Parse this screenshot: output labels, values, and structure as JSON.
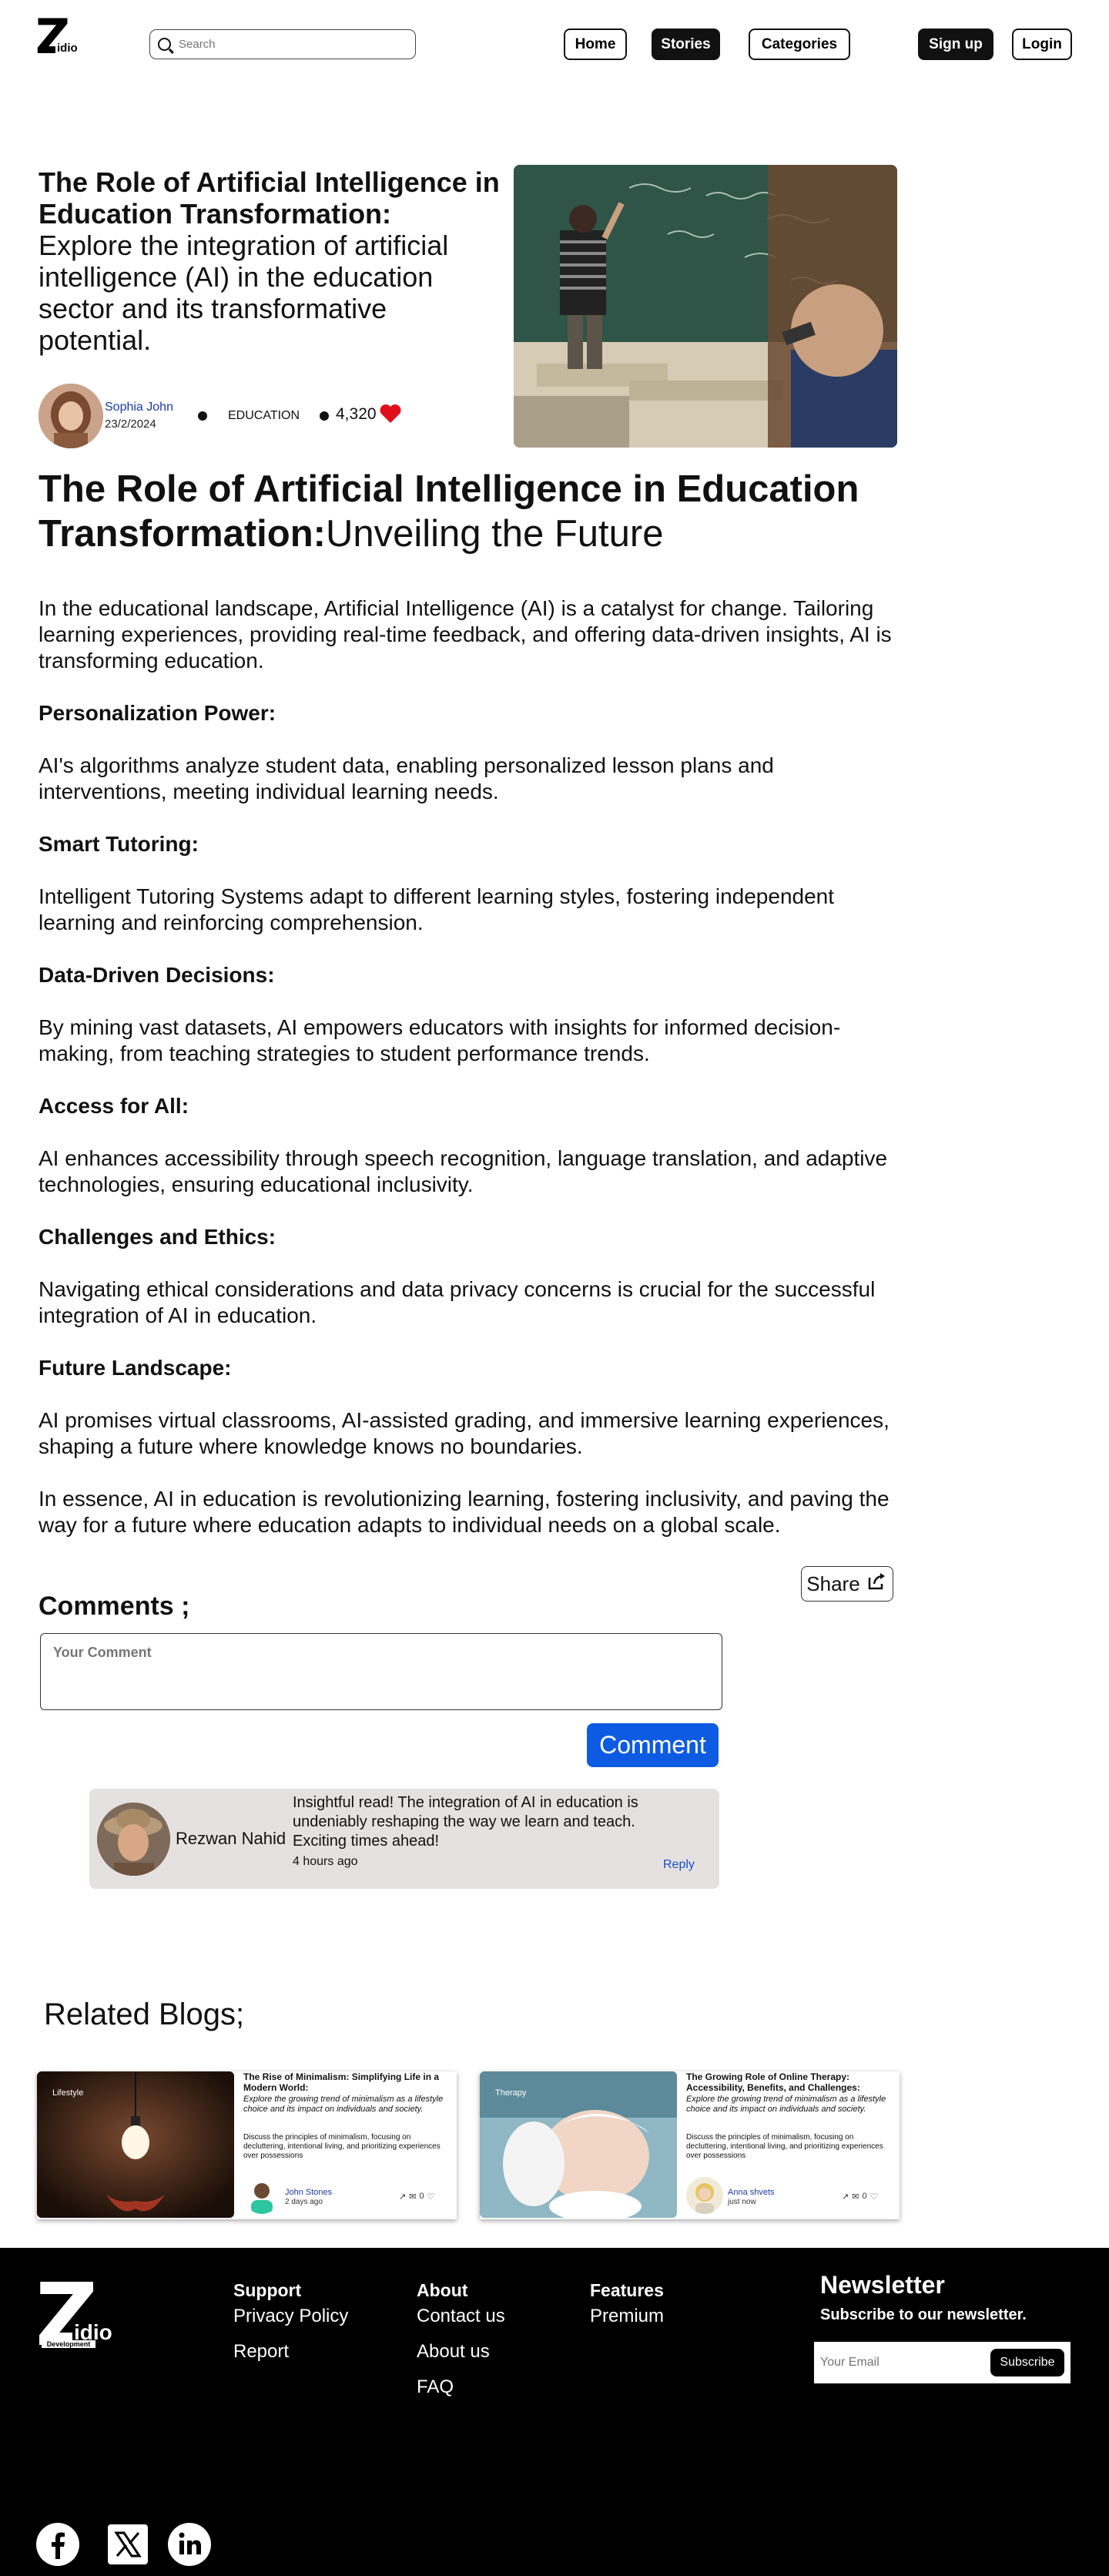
{
  "nav": {
    "logo_letter": "Z",
    "logo_text": "idio",
    "search_placeholder": "Search",
    "links": {
      "home": "Home",
      "stories": "Stories",
      "categories": "Categories"
    },
    "signup": "Sign up",
    "login": "Login"
  },
  "hero": {
    "title_bold": "The Role of Artificial Intelligence in Education Transformation:",
    "title_sub": "Explore the integration of artificial intelligence (AI) in the education sector and its transformative potential.",
    "author": "Sophia John",
    "date": "23/2/2024",
    "category": "EDUCATION",
    "likes": "4,320"
  },
  "article": {
    "title_bold": "The Role of Artificial Intelligence in Education Transformation:",
    "title_rest": "Unveiling the Future",
    "intro": "In the educational landscape, Artificial Intelligence (AI) is a catalyst for change. Tailoring learning experiences, providing real-time feedback, and offering data-driven insights, AI is transforming education.",
    "sections": [
      {
        "heading": "Personalization Power:",
        "text": "AI's algorithms analyze student data, enabling personalized lesson plans and interventions, meeting individual learning needs."
      },
      {
        "heading": "Smart Tutoring:",
        "text": "Intelligent Tutoring Systems adapt to different learning styles, fostering independent learning and reinforcing comprehension."
      },
      {
        "heading": "Data-Driven Decisions:",
        "text": "By mining vast datasets, AI empowers educators with insights for informed decision-making, from teaching strategies to student performance trends."
      },
      {
        "heading": "Access for All:",
        "text": "AI enhances accessibility through speech recognition, language translation, and adaptive technologies, ensuring educational inclusivity."
      },
      {
        "heading": "Challenges and Ethics:",
        "text": "Navigating ethical considerations and data privacy concerns is crucial for the successful integration of AI in education."
      },
      {
        "heading": "Future Landscape:",
        "text": "AI promises virtual classrooms, AI-assisted grading, and immersive learning experiences, shaping a future where knowledge knows no boundaries."
      }
    ],
    "conclusion": "In essence, AI in education is revolutionizing learning, fostering inclusivity, and paving the way for a future where education adapts to individual needs on a global scale.",
    "share": "Share"
  },
  "comments": {
    "title": "Comments ;",
    "placeholder": "Your Comment",
    "button": "Comment",
    "items": [
      {
        "name": "Rezwan Nahid",
        "text": "Insightful read! The integration of AI in education is undeniably reshaping the way we learn and teach. Exciting times ahead!",
        "time": "4 hours ago",
        "reply": "Reply"
      }
    ]
  },
  "related": {
    "title": "Related Blogs;",
    "cards": [
      {
        "tag": "Lifestyle",
        "title": "The Rise of Minimalism: Simplifying Life in a Modern World:",
        "desc": "Explore the growing trend of minimalism as a lifestyle choice and its impact on individuals and society.",
        "desc2": "Discuss the principles of minimalism, focusing on decluttering, intentional living, and prioritizing experiences over possessions",
        "author": "John Stones",
        "time": "2 days ago",
        "count": "0"
      },
      {
        "tag": "Therapy",
        "title": "The Growing Role of Online Therapy: Accessibility, Benefits, and Challenges:",
        "desc": "Explore the growing trend of minimalism as a lifestyle choice and its impact on individuals and society.",
        "desc2": "Discuss the principles of minimalism, focusing on decluttering, intentional living, and prioritizing experiences over possessions",
        "author": "Anna shvets",
        "time": "just now",
        "count": "0"
      }
    ]
  },
  "footer": {
    "logo_letter": "Z",
    "logo_text": "idio",
    "logo_sub": "Development",
    "support": {
      "title": "Support",
      "links": [
        "Privacy Policy",
        "Report"
      ]
    },
    "about": {
      "title": "About",
      "links": [
        "Contact us",
        "About us",
        "FAQ"
      ]
    },
    "features": {
      "title": "Features",
      "links": [
        "Premium"
      ]
    },
    "newsletter": {
      "title": "Newsletter",
      "subtitle": "Subscribe to our newsletter.",
      "placeholder": "Your Email",
      "button": "Subscribe"
    },
    "social": [
      "facebook-icon",
      "x-icon",
      "linkedin-icon"
    ]
  },
  "colors": {
    "accent": "#0d5be2",
    "heart": "#e0101a",
    "link": "#1b3aa8",
    "footer_bg": "#000000"
  }
}
